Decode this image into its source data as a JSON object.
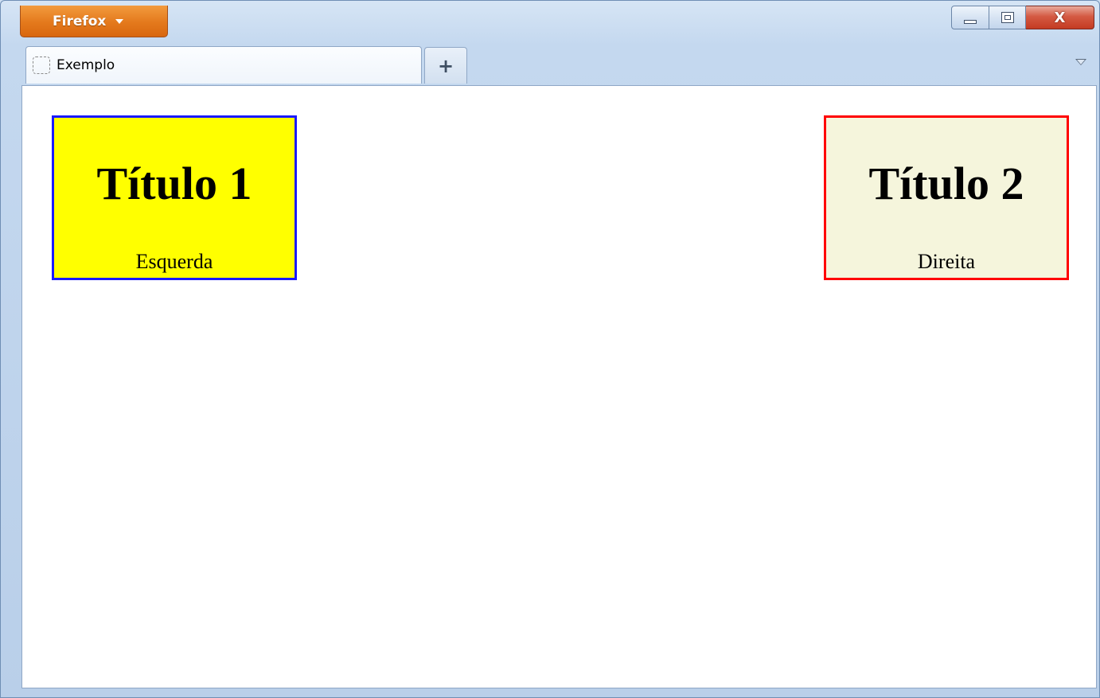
{
  "titlebar": {
    "app_button_label": "Firefox",
    "close_label": "X"
  },
  "tabs": [
    {
      "label": "Exemplo",
      "icon": "blank-page-icon"
    }
  ],
  "new_tab_label": "+",
  "page": {
    "boxes": [
      {
        "heading": "Título 1",
        "caption": "Esquerda",
        "background": "#ffff00",
        "border": "#1a1aff"
      },
      {
        "heading": "Título 2",
        "caption": "Direita",
        "background": "#f5f5dc",
        "border": "#ff0000"
      }
    ]
  }
}
